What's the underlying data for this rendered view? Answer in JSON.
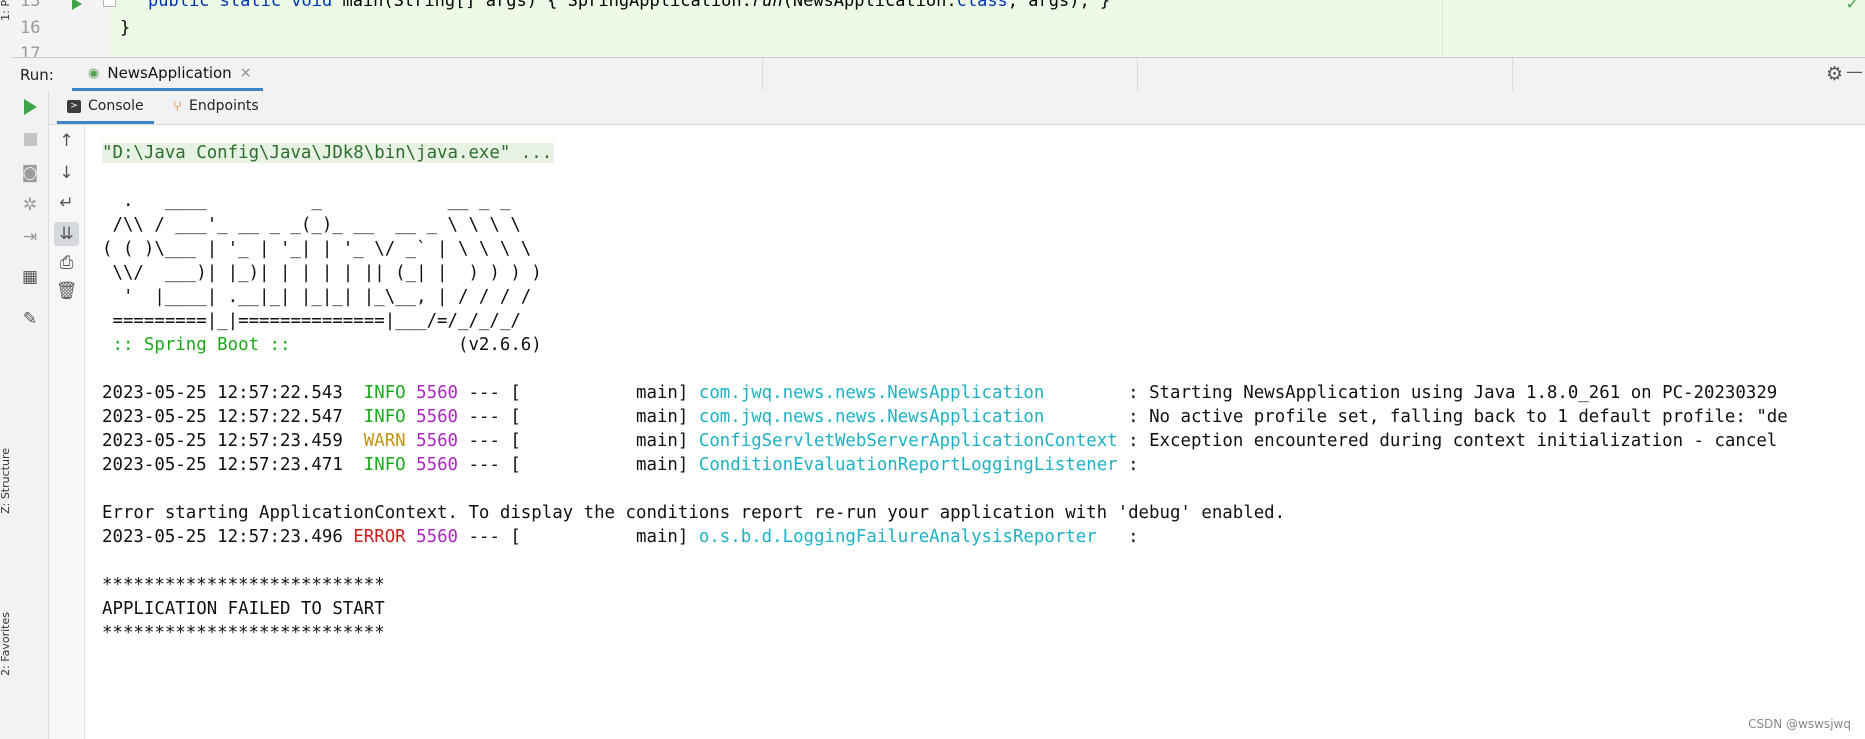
{
  "left_strip": {
    "tab_top": "1: P",
    "tab_structure": "Z: Structure",
    "tab_favorites": "2: Favorites"
  },
  "editor": {
    "lines": [
      {
        "number": "13",
        "kw": "public static void ",
        "method": "main",
        "mid": "(String[] args) { SpringApplication.",
        "call": "run",
        "args": "(NewsApplication.",
        "cls": "class",
        "end": ", args); }"
      },
      {
        "number": "16",
        "text": "}"
      },
      {
        "number": "17"
      }
    ]
  },
  "run_window": {
    "label": "Run:",
    "active_tab": "NewsApplication",
    "close_glyph": "×",
    "gear_icon": "⚙",
    "minimize_icon": "—"
  },
  "console_tabs": {
    "console": "Console",
    "endpoints": "Endpoints"
  },
  "console": {
    "command": "\"D:\\Java Config\\Java\\JDk8\\bin\\java.exe\" ...",
    "banner": [
      "  .   ____          _            __ _ _",
      " /\\\\ / ___'_ __ _ _(_)_ __  __ _ \\ \\ \\ \\",
      "( ( )\\___ | '_ | '_| | '_ \\/ _` | \\ \\ \\ \\",
      " \\\\/  ___)| |_)| | | | | || (_| |  ) ) ) )",
      "  '  |____| .__|_| |_|_| |_\\__, | / / / /",
      " =========|_|==============|___/=/_/_/_/"
    ],
    "spring_label": " :: Spring Boot :: ",
    "spring_version": "               (v2.6.6)",
    "logs": [
      {
        "time": "2023-05-25 12:57:22.543",
        "level": "INFO",
        "pid": "5560",
        "thread": " --- [           main] ",
        "logger": "com.jwq.news.news.NewsApplication       ",
        "msg": " : Starting NewsApplication using Java 1.8.0_261 on PC-20230329"
      },
      {
        "time": "2023-05-25 12:57:22.547",
        "level": "INFO",
        "pid": "5560",
        "thread": " --- [           main] ",
        "logger": "com.jwq.news.news.NewsApplication       ",
        "msg": " : No active profile set, falling back to 1 default profile: \"de"
      },
      {
        "time": "2023-05-25 12:57:23.459",
        "level": "WARN",
        "pid": "5560",
        "thread": " --- [           main] ",
        "logger": "ConfigServletWebServerApplicationContext",
        "msg": " : Exception encountered during context initialization - cancel"
      },
      {
        "time": "2023-05-25 12:57:23.471",
        "level": "INFO",
        "pid": "5560",
        "thread": " --- [           main] ",
        "logger": "ConditionEvaluationReportLoggingListener",
        "msg": " :"
      }
    ],
    "error_context": "Error starting ApplicationContext. To display the conditions report re-run your application with 'debug' enabled.",
    "error_log": {
      "time": "2023-05-25 12:57:23.496",
      "level": "ERROR",
      "pid": "5560",
      "thread": " --- [           main] ",
      "logger": "o.s.b.d.LoggingFailureAnalysisReporter  ",
      "msg": " :"
    },
    "stars": "***************************",
    "failed": "APPLICATION FAILED TO START"
  },
  "watermark": "CSDN @wswsjwq"
}
